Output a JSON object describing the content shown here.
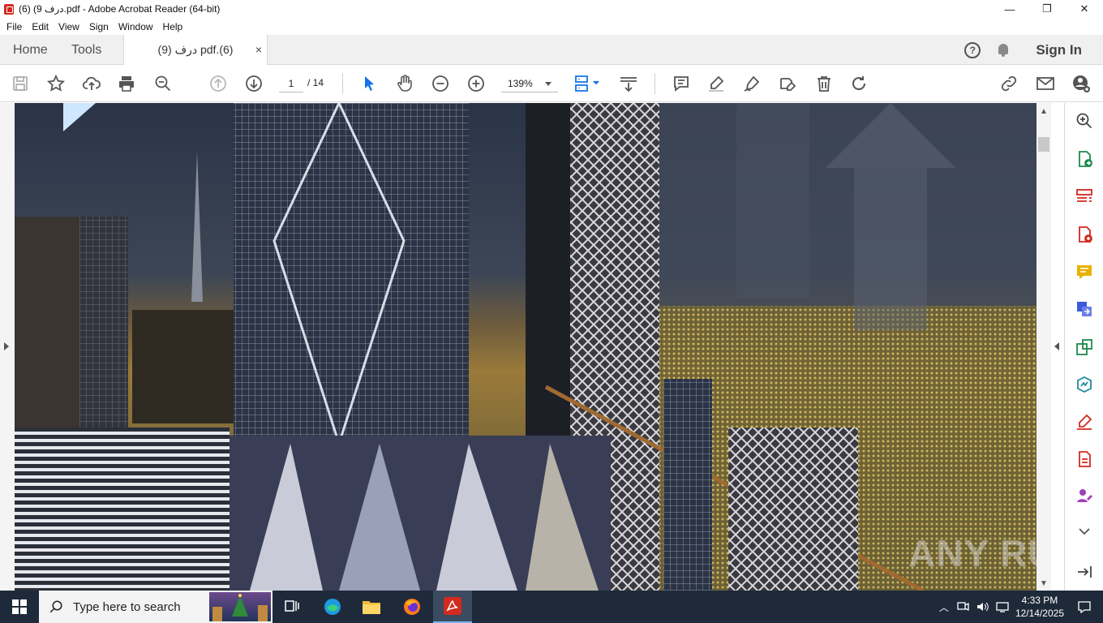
{
  "window": {
    "title": "درف 9) (6).pdf - Adobe Acrobat Reader (64-bit)",
    "minimize": "—",
    "maximize": "❐",
    "close": "✕"
  },
  "menu": [
    "File",
    "Edit",
    "View",
    "Sign",
    "Window",
    "Help"
  ],
  "tabs": {
    "home": "Home",
    "tools": "Tools",
    "document": "درف (9) pdf.(6)",
    "close": "×",
    "help": "?",
    "sign_in": "Sign In"
  },
  "toolbar": {
    "page_current": "1",
    "page_total": "/  14",
    "zoom": "139%"
  },
  "watermark": "ANY RUN",
  "taskbar": {
    "search_placeholder": "Type here to search",
    "time": "4:33 PM",
    "date": "12/14/2025"
  },
  "colors": {
    "acrobat_red": "#d32a1e",
    "tool_blue": "#1473e6",
    "taskbar": "#1e2a3a"
  }
}
